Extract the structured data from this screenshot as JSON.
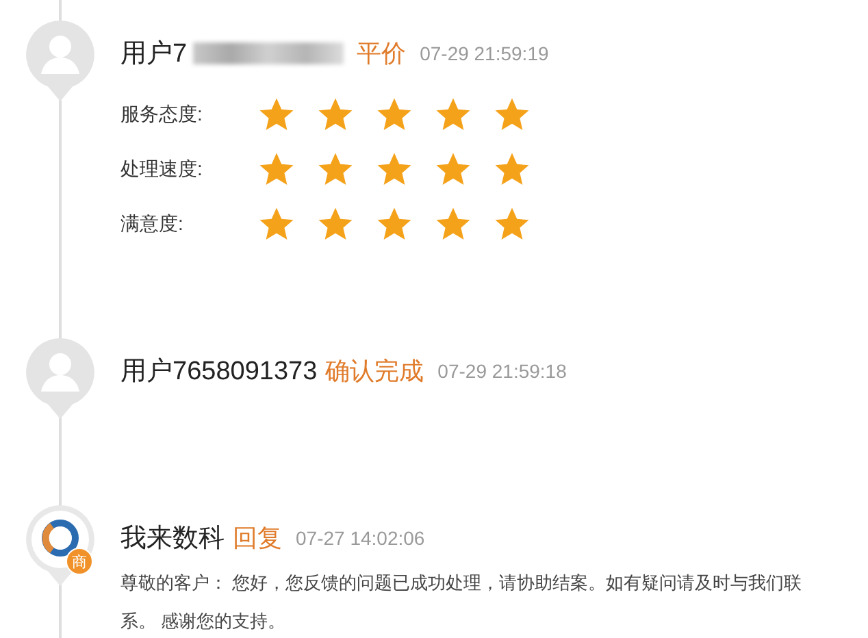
{
  "entries": [
    {
      "kind": "rating",
      "user": "用户7",
      "redacted": true,
      "action": "平价",
      "time": "07-29 21:59:19",
      "ratings": [
        {
          "label": "服务态度:",
          "stars": 5
        },
        {
          "label": "处理速度:",
          "stars": 5
        },
        {
          "label": "满意度:",
          "stars": 5
        }
      ]
    },
    {
      "kind": "status",
      "user": "用户7658091373",
      "action": "确认完成",
      "time": "07-29 21:59:18"
    },
    {
      "kind": "reply",
      "badge": "商",
      "user": "我来数科",
      "action": "回复",
      "time": "07-27 14:02:06",
      "body": "尊敬的客户： 您好，您反馈的问题已成功处理，请协助结案。如有疑问请及时与我们联系。 感谢您的支持。"
    }
  ]
}
